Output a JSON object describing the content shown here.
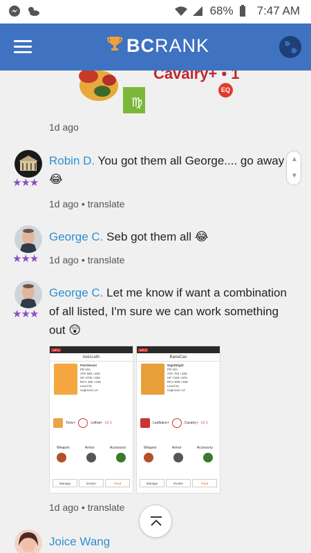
{
  "status_bar": {
    "battery": "68%",
    "time": "7:47 AM"
  },
  "app_bar": {
    "brand_bc": "BC",
    "brand_rank": "RANK"
  },
  "previous_post": {
    "title_partial": "Cavalry+ • 1",
    "badge": "EQ",
    "timestamp": "1d ago"
  },
  "comments": [
    {
      "author": "Robin D.",
      "text": " You got them all George.... go away",
      "emoji": "😂",
      "rating": "★★★",
      "timestamp": "1d ago",
      "action": "translate"
    },
    {
      "author": "George C.",
      "text": " Seb got them all",
      "emoji": "😂",
      "rating": "★★★",
      "timestamp": "1d ago",
      "action": "translate"
    },
    {
      "author": "George C.",
      "text": " Let me know if want a combination of all listed, I'm sure we can work something out",
      "emoji": "😲",
      "rating": "★★★",
      "timestamp": "1d ago",
      "action": "translate"
    },
    {
      "author": "Joice Wang"
    }
  ],
  "attached_screenshots": [
    {
      "vip": "VIP 6",
      "title": "toxicLeth",
      "hero_name": "Patchbeast",
      "stats": [
        "PR  N/A",
        "ATK 586 +200",
        "HP 4700 +250",
        "RCV 490 +245",
        "Level 01",
        "Capricorn L0"
      ],
      "ability_1": "Toxic+",
      "ability_2": "Lethal+",
      "ability_2_level": "LV 1",
      "equipment_labels": [
        "Weapon",
        "Armor",
        "Accessory"
      ],
      "buttons": [
        "Manage",
        "Evolve",
        "Feed"
      ]
    },
    {
      "vip": "VIP 6",
      "title": "BaneCav",
      "hero_name": "Nightblight",
      "stats": [
        "PR  N/A",
        "ATK 703 +339",
        "HP 7150 +975",
        "RCV 698 +349",
        "Level 01",
        "Capricorn L0"
      ],
      "ability_1": "Leafbane+",
      "ability_2": "Cavalry+",
      "ability_2_level": "LV 1",
      "equipment_labels": [
        "Weapon",
        "Armor",
        "Accessory"
      ],
      "buttons": [
        "Manage",
        "Evolve",
        "Feed"
      ]
    }
  ],
  "colors": {
    "app_bar": "#3f72c0",
    "author_link": "#2f8fd1",
    "stars": "#8a4fbf",
    "title_red": "#c0272d"
  }
}
